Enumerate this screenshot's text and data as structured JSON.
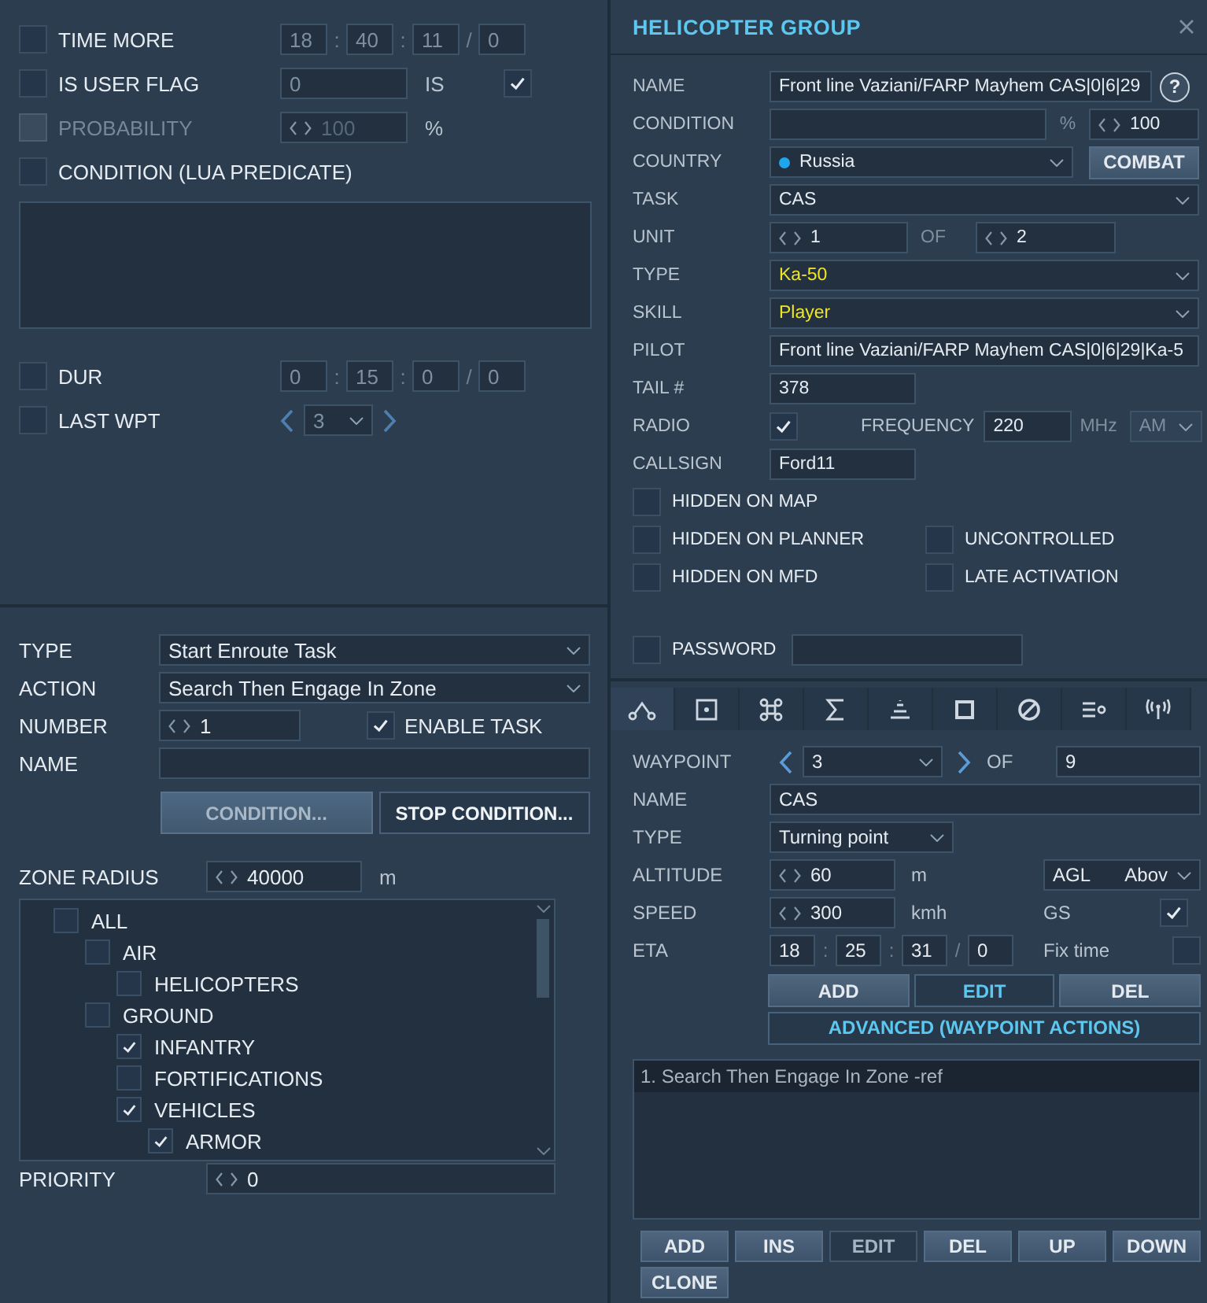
{
  "conditions": {
    "rows": [
      {
        "kind": "time",
        "label": "TIME MORE",
        "checked": false,
        "disabled": false,
        "parts": [
          "18",
          "40",
          "11",
          "0"
        ],
        "separators": [
          ":",
          ":",
          "/"
        ]
      },
      {
        "kind": "flag",
        "label": "IS USER FLAG",
        "checked": false,
        "disabled": false,
        "value": "0",
        "compare_label": "IS",
        "compare_checked": true
      },
      {
        "kind": "percent",
        "label": "PROBABILITY",
        "checked": false,
        "disabled": true,
        "value": "100",
        "unit": "%"
      },
      {
        "kind": "lua",
        "label": "CONDITION (LUA PREDICATE)",
        "checked": false,
        "disabled": false
      },
      {
        "kind": "time",
        "label": "DUR",
        "checked": false,
        "disabled": false,
        "parts": [
          "0",
          "15",
          "0",
          "0"
        ],
        "separators": [
          ":",
          ":",
          "/"
        ]
      },
      {
        "kind": "waypoint",
        "label": "LAST WPT",
        "checked": false,
        "disabled": false,
        "value": "3"
      }
    ]
  },
  "task": {
    "fields": [
      {
        "kind": "dropdown",
        "label": "TYPE",
        "value": "Start Enroute Task"
      },
      {
        "kind": "dropdown",
        "label": "ACTION",
        "value": "Search Then Engage In Zone"
      },
      {
        "kind": "number",
        "label": "NUMBER",
        "value": "1",
        "toggle": {
          "label": "ENABLE TASK",
          "checked": true
        }
      },
      {
        "kind": "text",
        "label": "NAME"
      }
    ],
    "buttons": [
      {
        "label": "CONDITION...",
        "selected": true
      },
      {
        "label": "STOP CONDITION...",
        "selected": false
      }
    ],
    "zone_radius": {
      "label": "ZONE RADIUS",
      "value": "40000",
      "unit": "m"
    },
    "targets": [
      {
        "label": "ALL",
        "checked": false,
        "children": [
          {
            "label": "AIR",
            "checked": false,
            "children": [
              {
                "label": "HELICOPTERS",
                "checked": false
              }
            ]
          },
          {
            "label": "GROUND",
            "checked": false,
            "children": [
              {
                "label": "INFANTRY",
                "checked": true
              },
              {
                "label": "FORTIFICATIONS",
                "checked": false
              },
              {
                "label": "VEHICLES",
                "checked": true,
                "children": [
                  {
                    "label": "ARMOR",
                    "checked": true
                  }
                ]
              }
            ]
          }
        ]
      }
    ],
    "priority": {
      "label": "PRIORITY",
      "value": "0"
    }
  },
  "group": {
    "title": "HELICOPTER GROUP",
    "fields": [
      {
        "kind": "name",
        "label": "NAME",
        "value": "Front line Vaziani/FARP Mayhem CAS|0|6|29",
        "help": "?"
      },
      {
        "kind": "condition",
        "label": "CONDITION",
        "unit": "%",
        "value": "100"
      },
      {
        "kind": "country",
        "label": "COUNTRY",
        "value": "Russia",
        "color": "#1ea5ee",
        "button": "COMBAT"
      },
      {
        "kind": "dropdown",
        "label": "TASK",
        "value": "CAS",
        "highlight": false
      },
      {
        "kind": "unit",
        "label": "UNIT",
        "value": "1",
        "of_label": "OF",
        "total": "2"
      },
      {
        "kind": "dropdown",
        "label": "TYPE",
        "value": "Ka-50",
        "highlight": true
      },
      {
        "kind": "dropdown",
        "label": "SKILL",
        "value": "Player",
        "highlight": true
      },
      {
        "kind": "text",
        "label": "PILOT",
        "value": "Front line Vaziani/FARP Mayhem CAS|0|6|29|Ka-5"
      },
      {
        "kind": "short",
        "label": "TAIL #",
        "value": "378"
      },
      {
        "kind": "radio",
        "label": "RADIO",
        "checked": true,
        "frequency_label": "FREQUENCY",
        "frequency": "220",
        "unit": "MHz",
        "modulation": "AM"
      },
      {
        "kind": "short",
        "label": "CALLSIGN",
        "value": "Ford11"
      }
    ],
    "option_rows": [
      {
        "items": [
          {
            "label": "HIDDEN ON MAP",
            "checked": false
          }
        ]
      },
      {
        "items": [
          {
            "label": "HIDDEN ON PLANNER",
            "checked": false
          },
          {
            "label": "UNCONTROLLED",
            "checked": false
          }
        ]
      },
      {
        "items": [
          {
            "label": "HIDDEN ON MFD",
            "checked": false
          },
          {
            "label": "LATE ACTIVATION",
            "checked": false
          }
        ]
      }
    ],
    "password": {
      "label": "PASSWORD",
      "checked": false
    }
  },
  "tabs": [
    {
      "kind": "route",
      "selected": true
    },
    {
      "kind": "target",
      "selected": false
    },
    {
      "kind": "command",
      "selected": false
    },
    {
      "kind": "sigma",
      "selected": false
    },
    {
      "kind": "layers",
      "selected": false
    },
    {
      "kind": "square",
      "selected": false
    },
    {
      "kind": "forbidden",
      "selected": false
    },
    {
      "kind": "list",
      "selected": false
    },
    {
      "kind": "antenna",
      "selected": false
    }
  ],
  "waypoint": {
    "index": {
      "label": "WAYPOINT",
      "value": "3",
      "of_label": "OF",
      "total": "9"
    },
    "name": {
      "label": "NAME",
      "value": "CAS"
    },
    "type": {
      "label": "TYPE",
      "value": "Turning point"
    },
    "altitude": {
      "label": "ALTITUDE",
      "value": "60",
      "unit": "m",
      "reference": "AGL",
      "reference_mode": "Abov"
    },
    "speed": {
      "label": "SPEED",
      "value": "300",
      "unit": "kmh",
      "lock_label": "GS",
      "locked": true
    },
    "eta": {
      "label": "ETA",
      "parts": [
        "18",
        "25",
        "31",
        "0"
      ],
      "separators": [
        ":",
        ":",
        "/"
      ],
      "lock_label": "Fix time",
      "locked": false
    },
    "buttons": [
      {
        "label": "ADD",
        "kind": "filled"
      },
      {
        "label": "EDIT",
        "kind": "accent"
      },
      {
        "label": "DEL",
        "kind": "filled"
      }
    ],
    "advanced": "ADVANCED (WAYPOINT ACTIONS)"
  },
  "actions": {
    "items": [
      {
        "label": "1. Search Then Engage In Zone -ref",
        "selected": true
      }
    ],
    "buttons": [
      {
        "label": "ADD",
        "kind": "filled"
      },
      {
        "label": "INS",
        "kind": "filled"
      },
      {
        "label": "EDIT",
        "kind": "outline"
      },
      {
        "label": "DEL",
        "kind": "filled"
      },
      {
        "label": "UP",
        "kind": "filled"
      },
      {
        "label": "DOWN",
        "kind": "filled"
      },
      {
        "label": "CLONE",
        "kind": "filled"
      }
    ]
  }
}
